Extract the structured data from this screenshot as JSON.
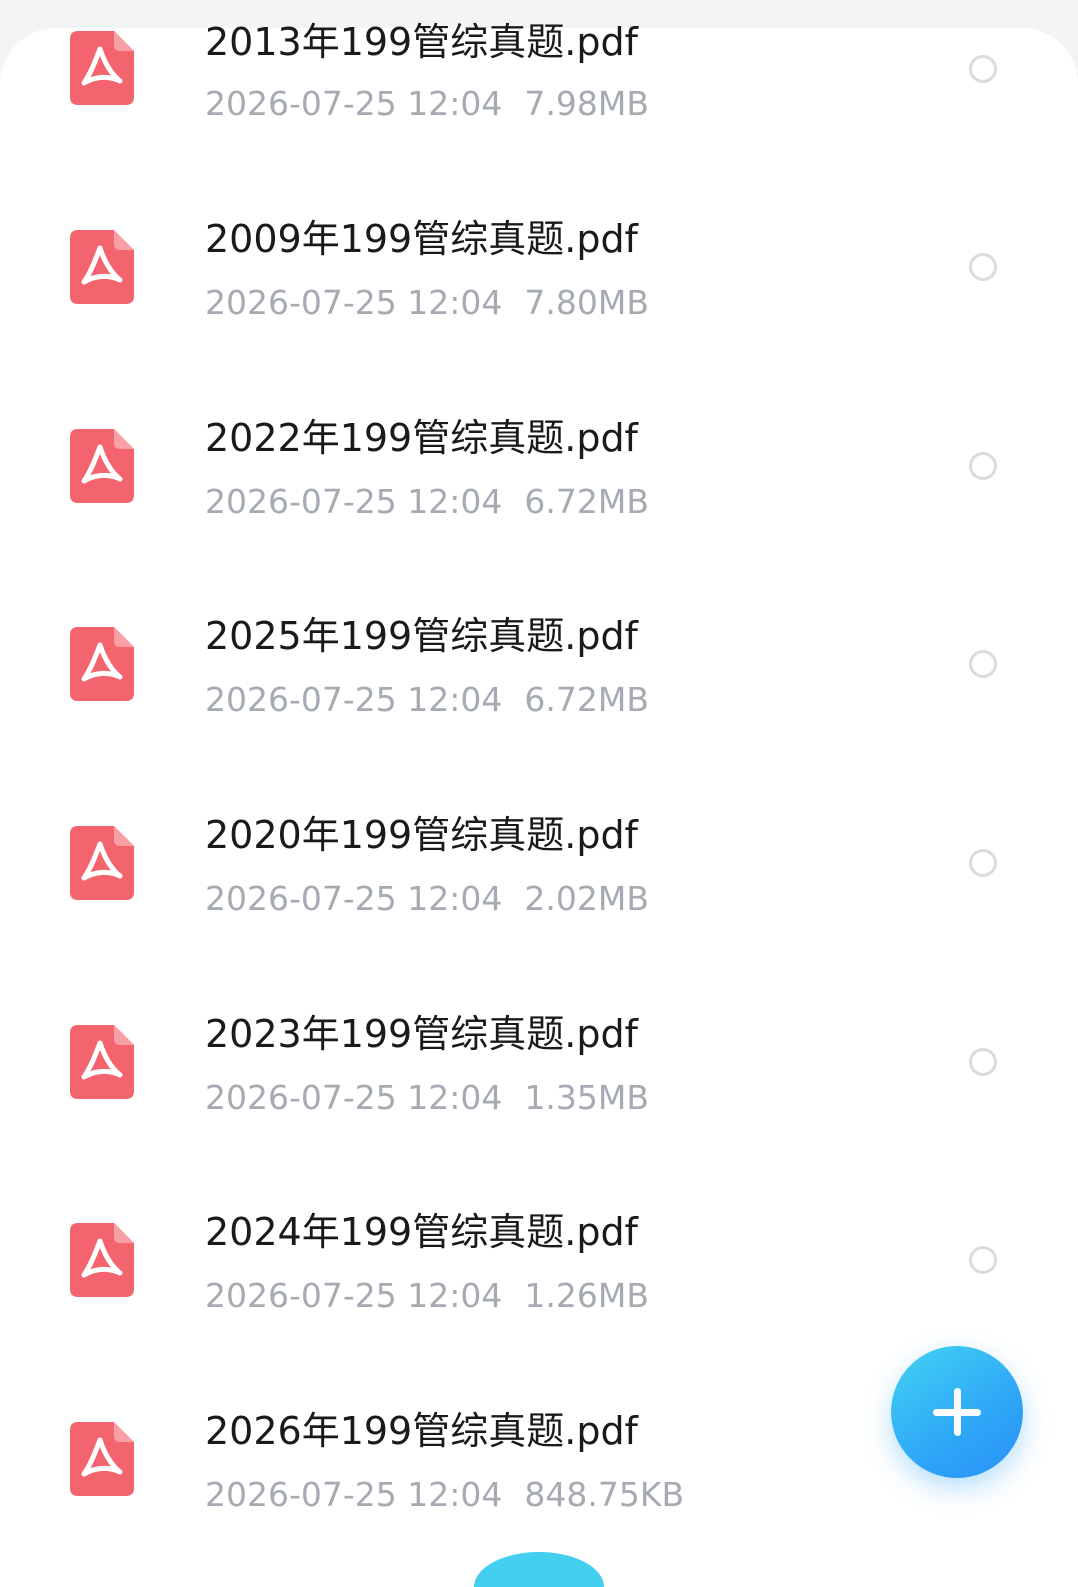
{
  "files": [
    {
      "name": "2013年199管综真题.pdf",
      "date": "2026-07-25 12:04",
      "size": "7.98MB",
      "icon": "pdf-icon"
    },
    {
      "name": "2009年199管综真题.pdf",
      "date": "2026-07-25 12:04",
      "size": "7.80MB",
      "icon": "pdf-icon"
    },
    {
      "name": "2022年199管综真题.pdf",
      "date": "2026-07-25 12:04",
      "size": "6.72MB",
      "icon": "pdf-icon"
    },
    {
      "name": "2025年199管综真题.pdf",
      "date": "2026-07-25 12:04",
      "size": "6.72MB",
      "icon": "pdf-icon"
    },
    {
      "name": "2020年199管综真题.pdf",
      "date": "2026-07-25 12:04",
      "size": "2.02MB",
      "icon": "pdf-icon"
    },
    {
      "name": "2023年199管综真题.pdf",
      "date": "2026-07-25 12:04",
      "size": "1.35MB",
      "icon": "pdf-icon"
    },
    {
      "name": "2024年199管综真题.pdf",
      "date": "2026-07-25 12:04",
      "size": "1.26MB",
      "icon": "pdf-icon"
    },
    {
      "name": "2026年199管综真题.pdf",
      "date": "2026-07-25 12:04",
      "size": "848.75KB",
      "icon": "pdf-icon"
    }
  ],
  "fab": {
    "icon": "plus-icon"
  },
  "colors": {
    "pdf_red": "#f4646e",
    "accent_blue": "#2ea7f7",
    "text_primary": "#1a1a1a",
    "text_secondary": "#a6abb3"
  }
}
